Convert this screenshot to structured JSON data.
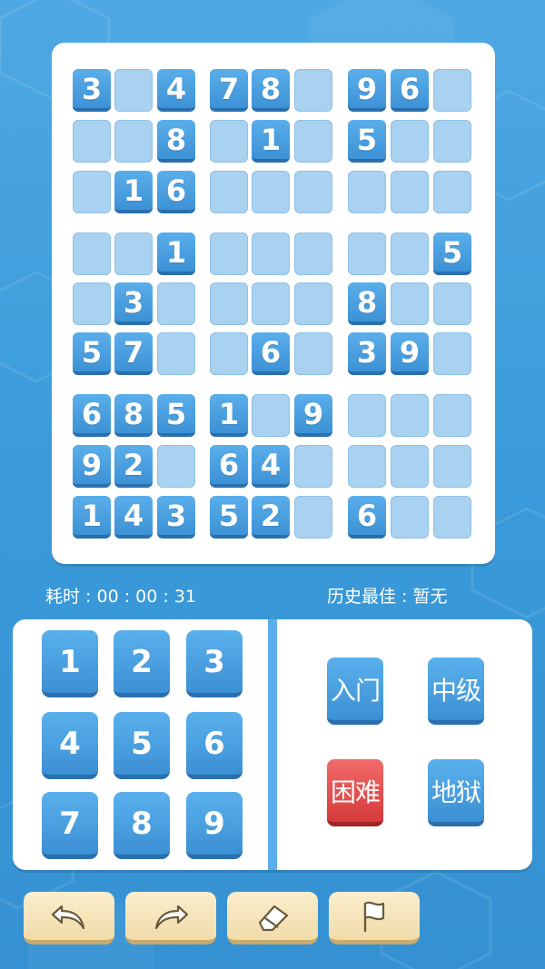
{
  "board": {
    "grid": [
      [
        "3",
        "",
        "4",
        "7",
        "8",
        "",
        "9",
        "6",
        ""
      ],
      [
        "",
        "",
        "8",
        "",
        "1",
        "",
        "5",
        "",
        ""
      ],
      [
        "",
        "1",
        "6",
        "",
        "",
        "",
        "",
        "",
        ""
      ],
      [
        "",
        "",
        "1",
        "",
        "",
        "",
        "",
        "",
        "5"
      ],
      [
        "",
        "3",
        "",
        "",
        "",
        "",
        "8",
        "",
        ""
      ],
      [
        "5",
        "7",
        "",
        "",
        "6",
        "",
        "3",
        "9",
        ""
      ],
      [
        "6",
        "8",
        "5",
        "1",
        "",
        "9",
        "",
        "",
        ""
      ],
      [
        "9",
        "2",
        "",
        "6",
        "4",
        "",
        "",
        "",
        ""
      ],
      [
        "1",
        "4",
        "3",
        "5",
        "2",
        "",
        "6",
        "",
        ""
      ]
    ]
  },
  "status": {
    "time_label": "耗时 : 00 : 00 : 31",
    "best_label": "历史最佳 : 暂无"
  },
  "keypad": [
    "1",
    "2",
    "3",
    "4",
    "5",
    "6",
    "7",
    "8",
    "9"
  ],
  "levels": [
    {
      "label": "入门",
      "active": false
    },
    {
      "label": "中级",
      "active": false
    },
    {
      "label": "困难",
      "active": true
    },
    {
      "label": "地狱",
      "active": false
    }
  ],
  "tools": [
    {
      "name": "undo-icon"
    },
    {
      "name": "redo-icon"
    },
    {
      "name": "eraser-icon"
    },
    {
      "name": "flag-icon"
    }
  ],
  "colors": {
    "background": "#3a9ad9",
    "cell_given": "#4a9fe0",
    "cell_empty": "#a9d2f0",
    "level_active": "#e04848",
    "tool_button": "#f6e4b8"
  }
}
